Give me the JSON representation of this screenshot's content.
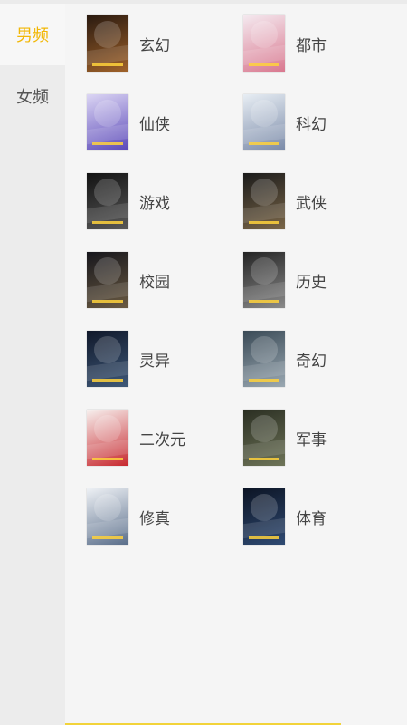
{
  "sidebar": {
    "tabs": [
      {
        "label": "男频",
        "active": true
      },
      {
        "label": "女频",
        "active": false
      }
    ]
  },
  "categories": [
    {
      "label": "玄幻",
      "cover_colors": [
        "#2a1a10",
        "#a0622a"
      ]
    },
    {
      "label": "都市",
      "cover_colors": [
        "#f4e9ef",
        "#d9788f"
      ]
    },
    {
      "label": "仙侠",
      "cover_colors": [
        "#dcd6f4",
        "#5a48b8"
      ]
    },
    {
      "label": "科幻",
      "cover_colors": [
        "#e8eef4",
        "#7a8aa8"
      ]
    },
    {
      "label": "游戏",
      "cover_colors": [
        "#121212",
        "#595959"
      ]
    },
    {
      "label": "武侠",
      "cover_colors": [
        "#1b1b1b",
        "#7a6648"
      ]
    },
    {
      "label": "校园",
      "cover_colors": [
        "#16161c",
        "#6a5a42"
      ]
    },
    {
      "label": "历史",
      "cover_colors": [
        "#242424",
        "#8a8a8a"
      ]
    },
    {
      "label": "灵异",
      "cover_colors": [
        "#10182a",
        "#3e5878"
      ]
    },
    {
      "label": "奇幻",
      "cover_colors": [
        "#3a4a56",
        "#9aa8b2"
      ]
    },
    {
      "label": "二次元",
      "cover_colors": [
        "#f7f1ef",
        "#c7282e"
      ]
    },
    {
      "label": "军事",
      "cover_colors": [
        "#2a2e22",
        "#6e7458"
      ]
    },
    {
      "label": "修真",
      "cover_colors": [
        "#eef1f5",
        "#5a6e8a"
      ]
    },
    {
      "label": "体育",
      "cover_colors": [
        "#0c1424",
        "#2f4a72"
      ]
    }
  ],
  "colors": {
    "accent": "#f2b705",
    "text": "#444444",
    "sidebar_bg": "#ececec",
    "content_bg": "#f5f5f5"
  }
}
